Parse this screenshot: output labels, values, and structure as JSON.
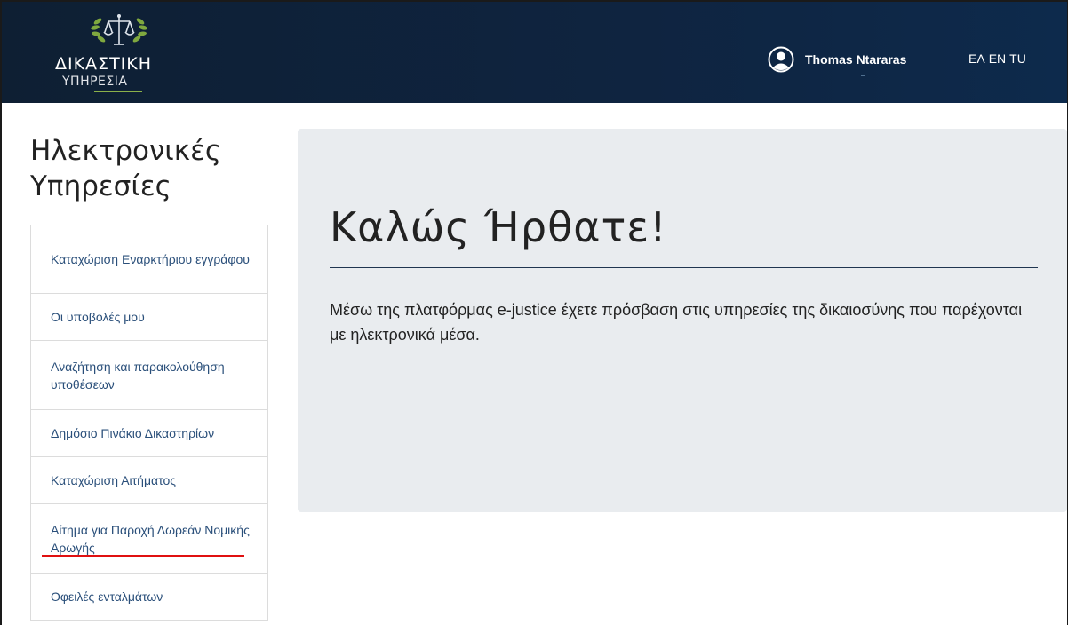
{
  "header": {
    "logo_line1": "ΔΙΚΑΣΤΙΚΗ",
    "logo_line2": "ΥΠΗΡΕΣΙΑ",
    "user_name": "Thomas Ntararas",
    "languages": [
      "ΕΛ",
      "EN",
      "TU"
    ]
  },
  "sidebar": {
    "title": "Ηλεκτρονικές Υπηρεσίες",
    "items": [
      {
        "label": "Καταχώριση Εναρκτήριου εγγράφου"
      },
      {
        "label": "Οι υποβολές μου"
      },
      {
        "label": "Αναζήτηση και παρακολούθηση υποθέσεων"
      },
      {
        "label": "Δημόσιο Πινάκιο Δικαστηρίων"
      },
      {
        "label": "Καταχώριση Αιτήματος"
      },
      {
        "label": "Αίτημα για Παροχή Δωρεάν Νομικής Αρωγής"
      },
      {
        "label": "Οφειλές ενταλμάτων"
      }
    ]
  },
  "main": {
    "welcome": "Καλώς Ήρθατε!",
    "intro": "Μέσω της πλατφόρμας e-justice έχετε πρόσβαση στις υπηρεσίες της δικαιοσύνης που παρέχονται με ηλεκτρονικά μέσα."
  },
  "colors": {
    "header_bg": "#0f2440",
    "panel_bg": "#e9ecef",
    "link": "#2a4f7a",
    "annotation_red": "#e01010",
    "logo_accent": "#8bb04a"
  },
  "icons": {
    "logo": "scales-of-justice-emblem",
    "user": "user-circle-icon"
  }
}
